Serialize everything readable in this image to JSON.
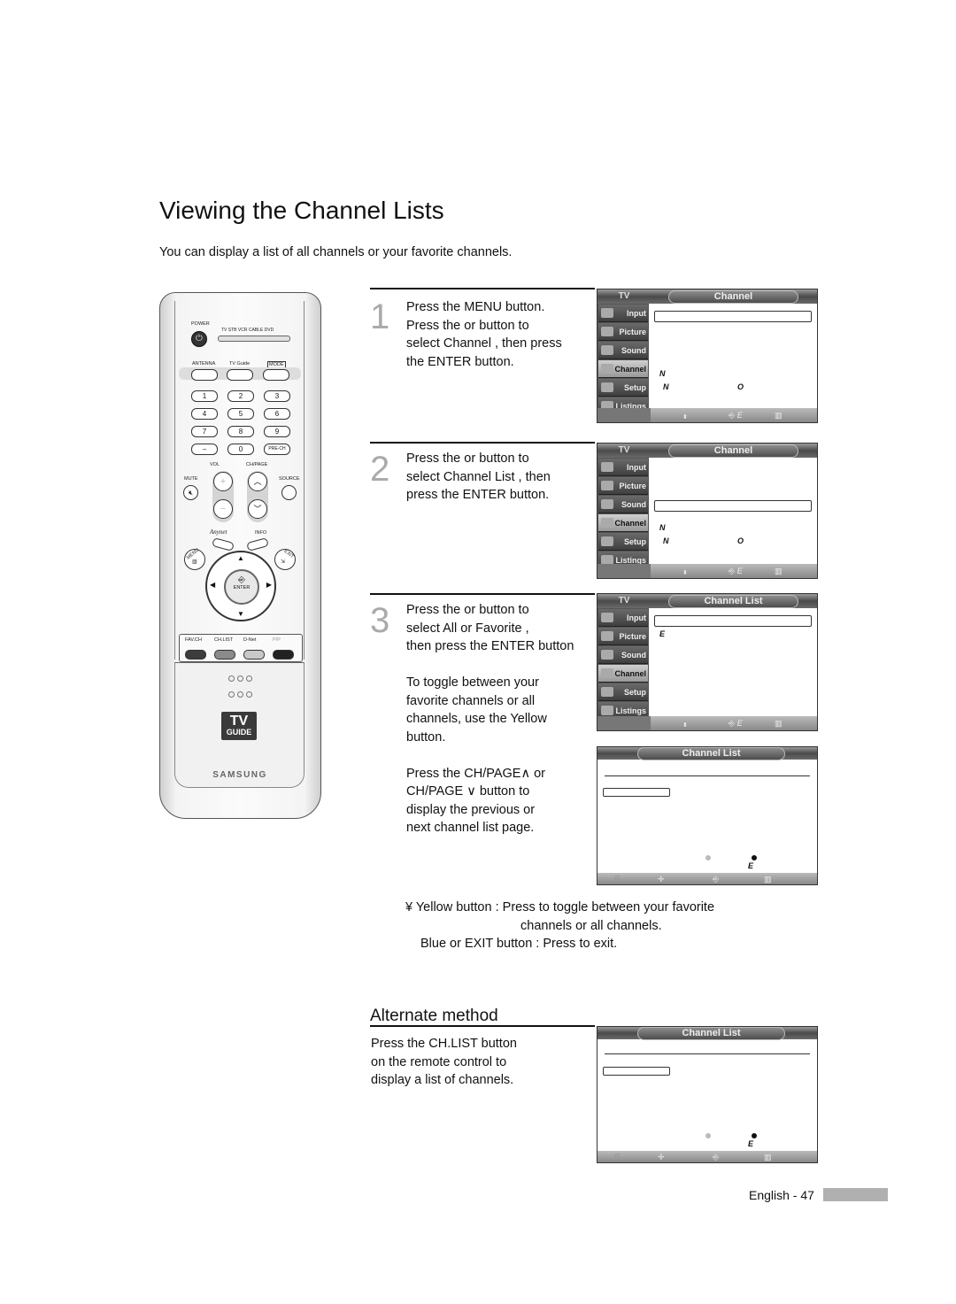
{
  "page": {
    "title": "Viewing the Channel Lists",
    "intro": "You can display a list of all channels or your favorite channels.",
    "footer": "English - 47"
  },
  "remote": {
    "power_label": "POWER",
    "sources": "TV  STB  VCR  CABLE  DVD",
    "top_buttons": [
      "ANTENNA",
      "TV Guide",
      "MODE"
    ],
    "keypad": [
      "1",
      "2",
      "3",
      "4",
      "5",
      "6",
      "7",
      "8",
      "9",
      "–",
      "0",
      "PRE-CH"
    ],
    "vol_label": "VOL",
    "ch_label": "CH/PAGE",
    "mute_label": "MUTE",
    "source_label": "SOURCE",
    "anynet_label": "Anynet",
    "info_label": "INFO",
    "menu_label": "MENU",
    "exit_label": "EXIT",
    "enter_label": "ENTER",
    "color_buttons": [
      {
        "label": "FAV.CH",
        "color": "#3c3c3c"
      },
      {
        "label": "CH.LIST",
        "color": "#8a8a8a"
      },
      {
        "label": "D-Net",
        "color": "#c8c8c8"
      },
      {
        "label": "PIP",
        "color": "#222222"
      }
    ],
    "tv_guide_top": "TV",
    "tv_guide_bottom": "GUIDE",
    "brand": "SAMSUNG"
  },
  "steps": [
    {
      "num": "1",
      "text": "Press the MENU button.\nPress the    or     button to\nselect  Channel , then press\nthe ENTER button."
    },
    {
      "num": "2",
      "text": "Press the    or     button to\nselect  Channel List , then\npress the ENTER button."
    },
    {
      "num": "3",
      "text": "Press the    or     button to\nselect  All  or  Favorite ,\nthen press the ENTER button\n\nTo toggle between your\nfavorite channels or all\nchannels, use the Yellow\nbutton.\n\nPress the CH/PAGE∧  or\nCH/PAGE ∨ button to\ndisplay the previous or\nnext channel list page."
    }
  ],
  "osd": {
    "tv_label": "TV",
    "menu_items": [
      "Input",
      "Picture",
      "Sound",
      "Channel",
      "Setup",
      "Listings"
    ],
    "active_item": "Channel",
    "screens": [
      {
        "title": "Channel",
        "marks": [
          "N",
          "N",
          "O"
        ]
      },
      {
        "title": "Channel",
        "marks": [
          "N",
          "N",
          "O"
        ]
      },
      {
        "title": "Channel List",
        "marks": [
          "E"
        ]
      },
      {
        "title": "Channel List",
        "marks": [
          "E"
        ]
      },
      {
        "title": "Channel List",
        "marks": [
          "E"
        ]
      }
    ],
    "foot_icons": {
      "move": "▲▼",
      "enter": "↲",
      "menu": "☰",
      "nav": "✛"
    }
  },
  "notes": {
    "yellow": "¥  Yellow button : Press to toggle between your favorite",
    "yellow_cont": "channels or all channels.",
    "blue": "Blue or EXIT button : Press to exit."
  },
  "alternate": {
    "title": "Alternate method",
    "text": "Press the CH.LIST button\non the remote control to\ndisplay a list of channels."
  }
}
